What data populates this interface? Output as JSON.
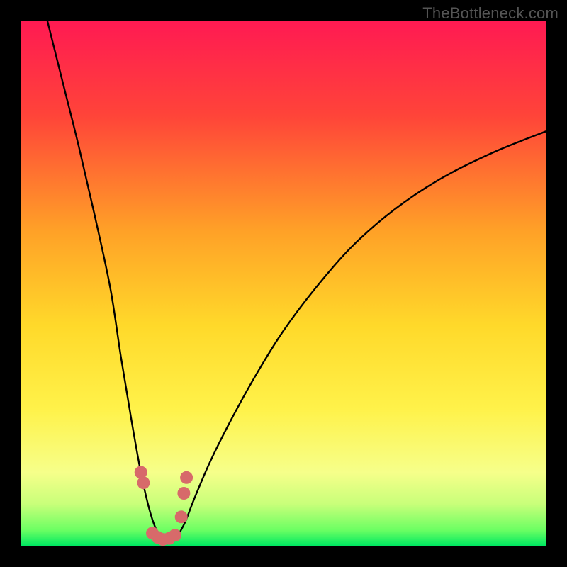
{
  "watermark": "TheBottleneck.com",
  "chart_data": {
    "type": "line",
    "title": "",
    "xlabel": "",
    "ylabel": "",
    "xlim": [
      0,
      100
    ],
    "ylim": [
      0,
      100
    ],
    "desc": "Bottleneck percentage vs. component balance. A V-shaped curve where the minimum (~0%) occurs at roughly x≈27 and bottleneck rises steeply on either side.",
    "series": [
      {
        "name": "bottleneck-curve",
        "x": [
          5,
          8,
          11,
          14,
          17,
          19,
          21,
          23,
          25,
          27,
          29,
          31,
          33,
          36,
          40,
          45,
          50,
          56,
          63,
          71,
          80,
          90,
          100
        ],
        "values": [
          100,
          88,
          76,
          63,
          49,
          36,
          24,
          13,
          5,
          1,
          1,
          4,
          9,
          16,
          24,
          33,
          41,
          49,
          57,
          64,
          70,
          75,
          79
        ]
      }
    ],
    "markers": {
      "name": "highlight-dots",
      "color": "#d76a6a",
      "x": [
        22.8,
        23.3,
        25.0,
        26.0,
        27.0,
        28.2,
        29.3,
        30.5,
        31.0,
        31.5
      ],
      "y": [
        14.0,
        12.0,
        2.4,
        1.6,
        1.2,
        1.4,
        2.0,
        5.5,
        10.0,
        13.0
      ]
    },
    "gradient_stops": [
      {
        "offset": 0.0,
        "color": "#ff1a52"
      },
      {
        "offset": 0.18,
        "color": "#ff4439"
      },
      {
        "offset": 0.4,
        "color": "#ffa127"
      },
      {
        "offset": 0.58,
        "color": "#ffd92a"
      },
      {
        "offset": 0.74,
        "color": "#fff24a"
      },
      {
        "offset": 0.86,
        "color": "#f6ff8a"
      },
      {
        "offset": 0.92,
        "color": "#c9ff7a"
      },
      {
        "offset": 0.97,
        "color": "#6cff63"
      },
      {
        "offset": 1.0,
        "color": "#00e861"
      }
    ]
  }
}
